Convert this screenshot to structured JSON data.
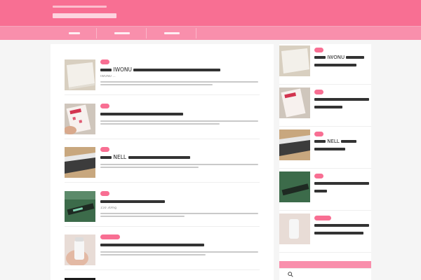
{
  "header": {
    "tagline": "",
    "site_title": "",
    "background": "#f86f93"
  },
  "nav": {
    "items": [
      {
        "label": ""
      },
      {
        "label": ""
      },
      {
        "label": ""
      }
    ]
  },
  "articles": [
    {
      "tag": "",
      "title": "IWONU",
      "excerpt": "IWONU ..."
    },
    {
      "tag": "",
      "title": "",
      "excerpt": ""
    },
    {
      "tag": "",
      "title": "NELL",
      "excerpt": ""
    },
    {
      "tag": "",
      "title": "",
      "excerpt": "150 30mg"
    },
    {
      "tag": "",
      "title": "",
      "excerpt": ""
    }
  ],
  "sidebar": {
    "items": [
      {
        "tag": "",
        "title": "IWONU"
      },
      {
        "tag": "",
        "title": ""
      },
      {
        "tag": "",
        "title": "NELL"
      },
      {
        "tag": "",
        "title": ""
      },
      {
        "tag": "",
        "title": ""
      }
    ],
    "search_icon": "search-icon"
  },
  "colors": {
    "accent": "#f86f93",
    "nav": "#f98fac",
    "page_bg": "#f5f5f5"
  }
}
